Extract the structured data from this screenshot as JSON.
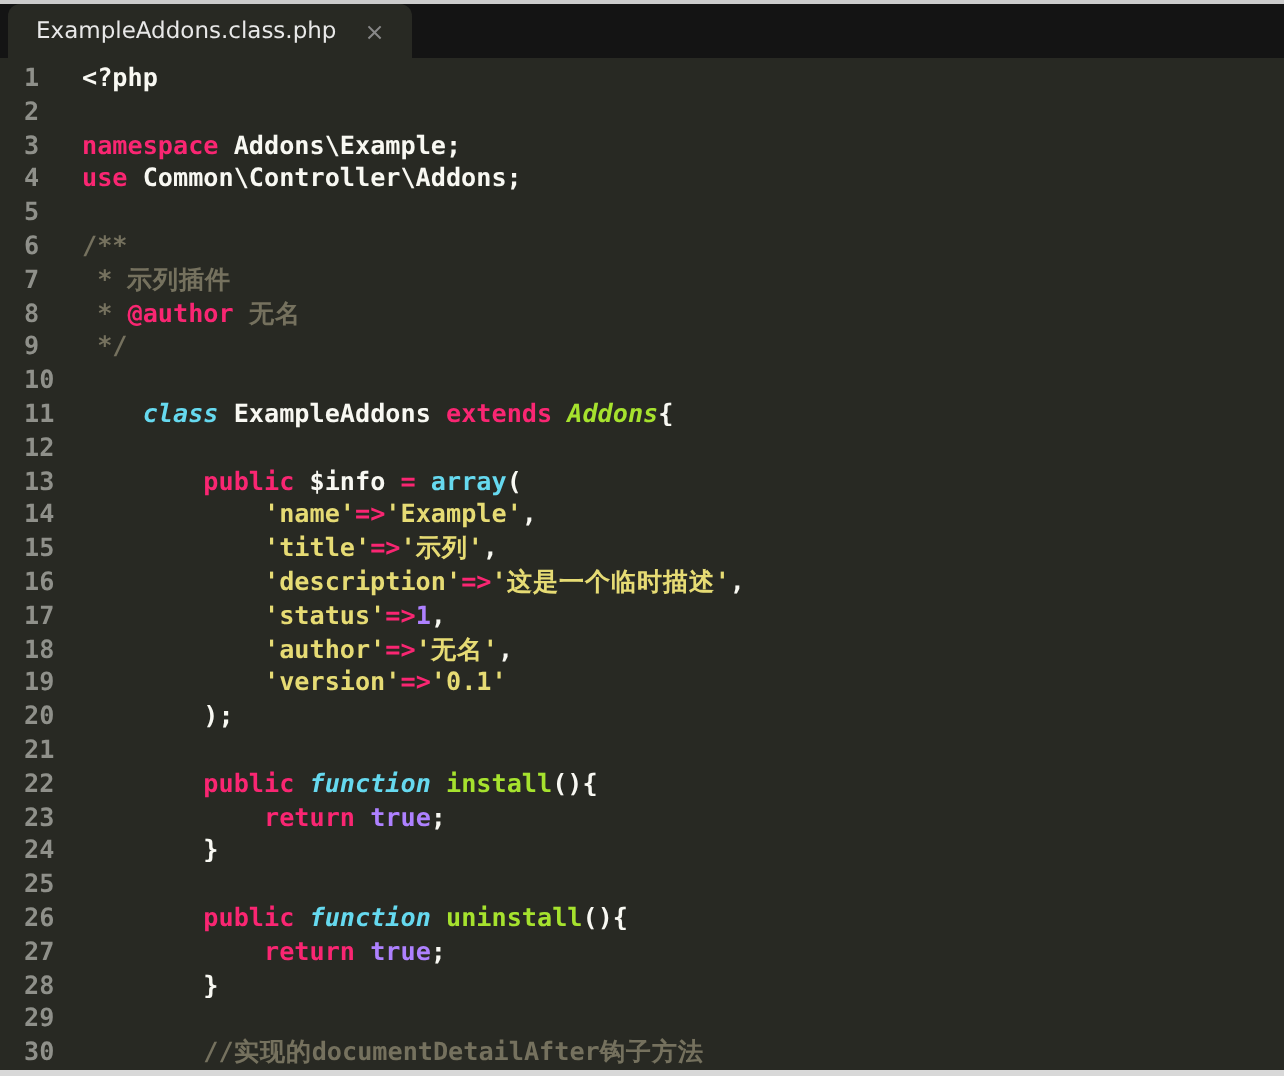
{
  "tabs": [
    {
      "label": "ExampleAddons.class.php",
      "close": "×",
      "selected": true
    }
  ],
  "lines": [
    {
      "number": "1",
      "tokens": [
        {
          "kind": "plain",
          "text": "<?php"
        }
      ]
    },
    {
      "number": "2"
    },
    {
      "number": "3",
      "tokens": [
        {
          "kind": "keyword",
          "text": "namespace"
        },
        {
          "kind": "plain",
          "text": " Addons\\Example;"
        }
      ]
    },
    {
      "number": "4",
      "tokens": [
        {
          "kind": "keyword",
          "text": "use"
        },
        {
          "kind": "plain",
          "text": " Common\\Controller\\Addons;"
        }
      ]
    },
    {
      "number": "5"
    },
    {
      "number": "6",
      "tokens": [
        {
          "kind": "comment",
          "text": "/**"
        }
      ]
    },
    {
      "number": "7",
      "tokens": [
        {
          "kind": "comment",
          "text": " * 示列插件"
        }
      ]
    },
    {
      "number": "8",
      "tokens": [
        {
          "kind": "comment",
          "text": " * "
        },
        {
          "kind": "keyword",
          "text": "@author"
        },
        {
          "kind": "comment",
          "text": " 无名"
        }
      ]
    },
    {
      "number": "9",
      "tokens": [
        {
          "kind": "comment",
          "text": " */"
        }
      ]
    },
    {
      "number": "10"
    },
    {
      "number": "11",
      "tokens": [
        {
          "kind": "storage",
          "text": "    class"
        },
        {
          "kind": "plain",
          "text": " ExampleAddons "
        },
        {
          "kind": "keyword",
          "text": "extends"
        },
        {
          "kind": "inherited",
          "text": " Addons"
        },
        {
          "kind": "plain",
          "text": "{"
        }
      ]
    },
    {
      "number": "12"
    },
    {
      "number": "13",
      "tokens": [
        {
          "kind": "keyword",
          "text": "        public"
        },
        {
          "kind": "plain",
          "text": " $info "
        },
        {
          "kind": "keyword",
          "text": "="
        },
        {
          "kind": "support",
          "text": " array"
        },
        {
          "kind": "plain",
          "text": "("
        }
      ]
    },
    {
      "number": "14",
      "tokens": [
        {
          "kind": "string",
          "text": "            'name'"
        },
        {
          "kind": "keyword",
          "text": "=>"
        },
        {
          "kind": "string",
          "text": "'Example'"
        },
        {
          "kind": "plain",
          "text": ","
        }
      ]
    },
    {
      "number": "15",
      "tokens": [
        {
          "kind": "string",
          "text": "            'title'"
        },
        {
          "kind": "keyword",
          "text": "=>"
        },
        {
          "kind": "string",
          "text": "'示列'"
        },
        {
          "kind": "plain",
          "text": ","
        }
      ]
    },
    {
      "number": "16",
      "tokens": [
        {
          "kind": "string",
          "text": "            'description'"
        },
        {
          "kind": "keyword",
          "text": "=>"
        },
        {
          "kind": "string",
          "text": "'这是一个临时描述'"
        },
        {
          "kind": "plain",
          "text": ","
        }
      ]
    },
    {
      "number": "17",
      "tokens": [
        {
          "kind": "string",
          "text": "            'status'"
        },
        {
          "kind": "keyword",
          "text": "=>"
        },
        {
          "kind": "number",
          "text": "1"
        },
        {
          "kind": "plain",
          "text": ","
        }
      ]
    },
    {
      "number": "18",
      "tokens": [
        {
          "kind": "string",
          "text": "            'author'"
        },
        {
          "kind": "keyword",
          "text": "=>"
        },
        {
          "kind": "string",
          "text": "'无名'"
        },
        {
          "kind": "plain",
          "text": ","
        }
      ]
    },
    {
      "number": "19",
      "tokens": [
        {
          "kind": "string",
          "text": "            'version'"
        },
        {
          "kind": "keyword",
          "text": "=>"
        },
        {
          "kind": "string",
          "text": "'0.1'"
        }
      ]
    },
    {
      "number": "20",
      "tokens": [
        {
          "kind": "plain",
          "text": "        );"
        }
      ]
    },
    {
      "number": "21"
    },
    {
      "number": "22",
      "tokens": [
        {
          "kind": "keyword",
          "text": "        public"
        },
        {
          "kind": "storage",
          "text": " function"
        },
        {
          "kind": "entity",
          "text": " install"
        },
        {
          "kind": "plain",
          "text": "(){"
        }
      ]
    },
    {
      "number": "23",
      "tokens": [
        {
          "kind": "keyword",
          "text": "            return"
        },
        {
          "kind": "constant",
          "text": " true"
        },
        {
          "kind": "plain",
          "text": ";"
        }
      ]
    },
    {
      "number": "24",
      "tokens": [
        {
          "kind": "plain",
          "text": "        }"
        }
      ]
    },
    {
      "number": "25"
    },
    {
      "number": "26",
      "tokens": [
        {
          "kind": "keyword",
          "text": "        public"
        },
        {
          "kind": "storage",
          "text": " function"
        },
        {
          "kind": "entity",
          "text": " uninstall"
        },
        {
          "kind": "plain",
          "text": "(){"
        }
      ]
    },
    {
      "number": "27",
      "tokens": [
        {
          "kind": "keyword",
          "text": "            return"
        },
        {
          "kind": "constant",
          "text": " true"
        },
        {
          "kind": "plain",
          "text": ";"
        }
      ]
    },
    {
      "number": "28",
      "tokens": [
        {
          "kind": "plain",
          "text": "        }"
        }
      ]
    },
    {
      "number": "29"
    },
    {
      "number": "30",
      "tokens": [
        {
          "kind": "comment",
          "text": "        //实现的documentDetailAfter钩子方法"
        }
      ]
    }
  ]
}
